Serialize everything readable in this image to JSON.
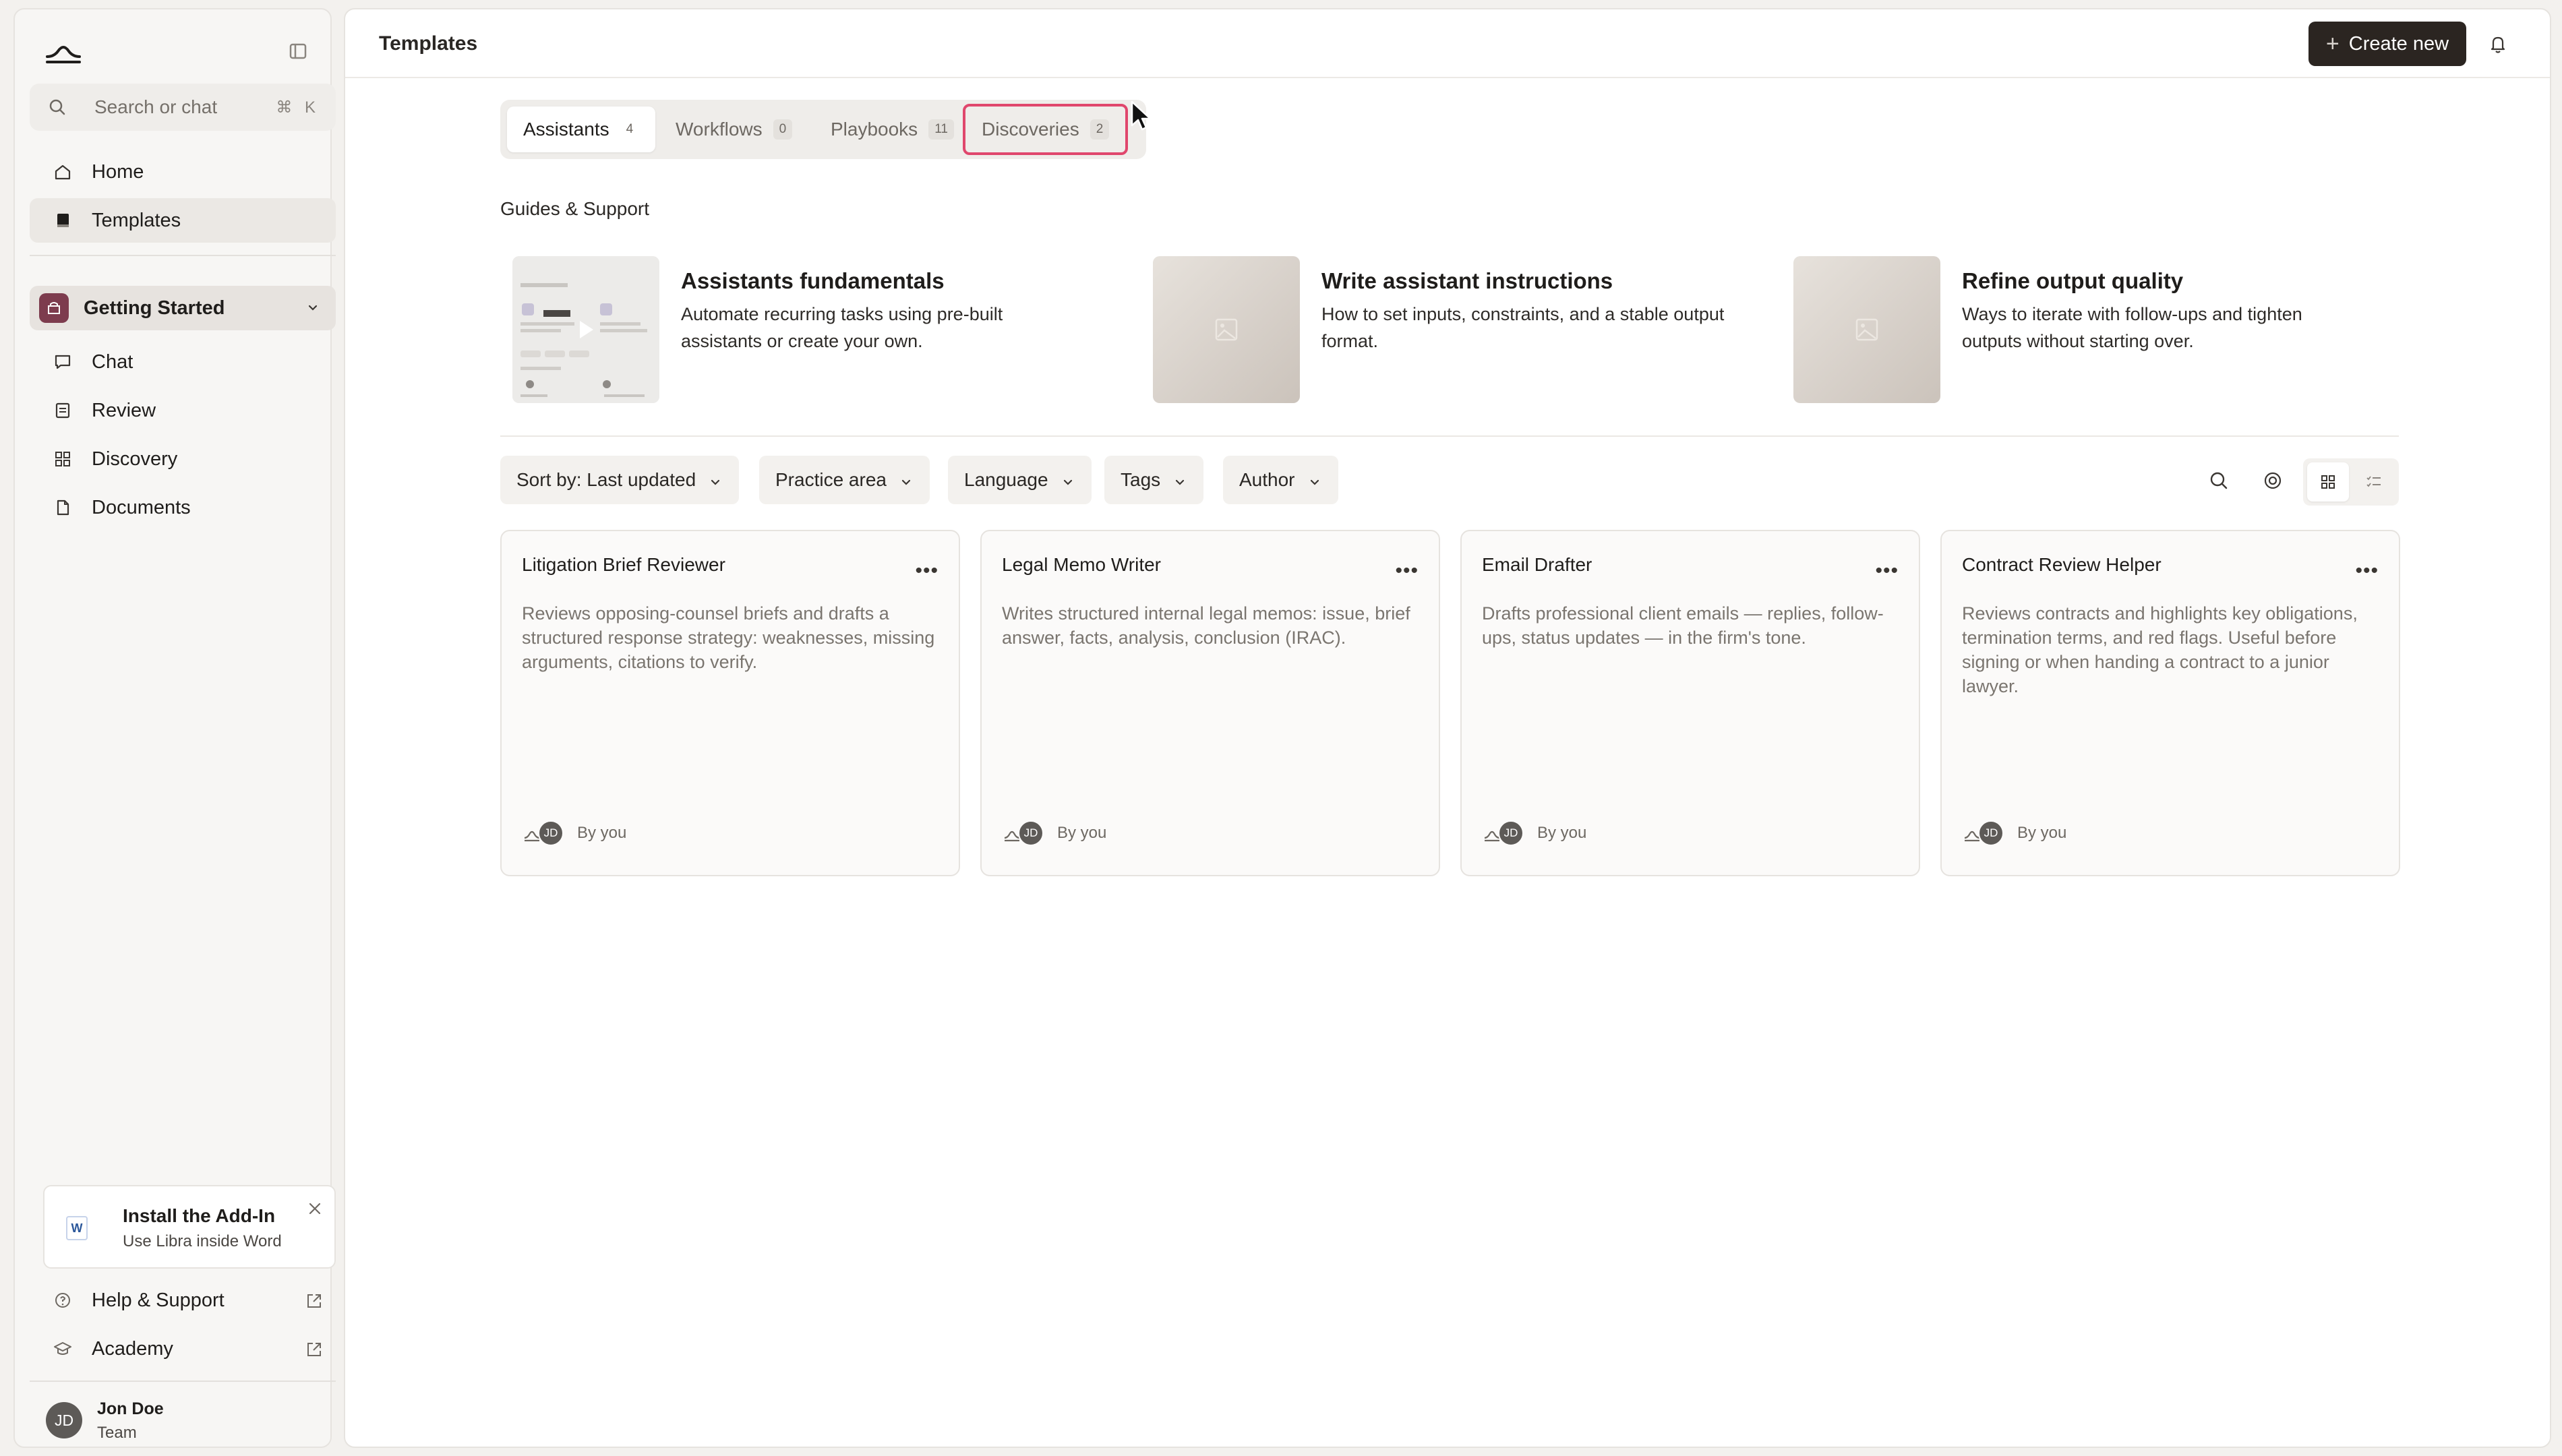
{
  "sidebar": {
    "search_placeholder": "Search or chat",
    "search_shortcut": "⌘ K",
    "nav": [
      {
        "label": "Home",
        "icon": "home-icon"
      },
      {
        "label": "Templates",
        "icon": "templates-icon"
      }
    ],
    "workspace": {
      "label": "Getting Started"
    },
    "workspace_nav": [
      {
        "label": "Chat",
        "icon": "chat-icon"
      },
      {
        "label": "Review",
        "icon": "review-icon"
      },
      {
        "label": "Discovery",
        "icon": "discovery-icon"
      },
      {
        "label": "Documents",
        "icon": "documents-icon"
      }
    ],
    "addin": {
      "title": "Install the Add-In",
      "subtitle": "Use Libra inside Word",
      "word_letter": "W"
    },
    "footer_links": [
      {
        "label": "Help & Support",
        "icon": "help-icon"
      },
      {
        "label": "Academy",
        "icon": "academy-icon"
      }
    ],
    "user": {
      "initials": "JD",
      "name": "Jon Doe",
      "team": "Team"
    }
  },
  "header": {
    "title": "Templates",
    "create_label": "Create new"
  },
  "tabs": [
    {
      "label": "Assistants",
      "count": "4"
    },
    {
      "label": "Workflows",
      "count": "0"
    },
    {
      "label": "Playbooks",
      "count": "11"
    },
    {
      "label": "Discoveries",
      "count": "2"
    }
  ],
  "guides": {
    "section_label": "Guides & Support",
    "items": [
      {
        "title": "Assistants fundamentals",
        "desc": "Automate recurring tasks using pre-built assistants or create your own."
      },
      {
        "title": "Write assistant instructions",
        "desc": "How to set inputs, constraints, and a stable output format."
      },
      {
        "title": "Refine output quality",
        "desc": "Ways to iterate with follow-ups and tighten outputs without starting over."
      }
    ]
  },
  "filters": {
    "sort_label": "Sort by: Last updated",
    "practice_area": "Practice area",
    "language": "Language",
    "tags": "Tags",
    "author": "Author"
  },
  "cards": [
    {
      "title": "Litigation Brief Reviewer",
      "desc": "Reviews opposing-counsel briefs and drafts a structured response strategy: weaknesses, missing arguments, citations to verify.",
      "author_initials": "JD",
      "by": "By you"
    },
    {
      "title": "Legal Memo Writer",
      "desc": "Writes structured internal legal memos: issue, brief answer, facts, analysis, conclusion (IRAC).",
      "author_initials": "JD",
      "by": "By you"
    },
    {
      "title": "Email Drafter",
      "desc": "Drafts professional client emails — replies, follow-ups, status updates — in the firm's tone.",
      "author_initials": "JD",
      "by": "By you"
    },
    {
      "title": "Contract Review Helper",
      "desc": "Reviews contracts and highlights key obligations, termination terms, and red flags. Useful before signing or when handing a contract to a junior lawyer.",
      "author_initials": "JD",
      "by": "By you"
    }
  ],
  "colors": {
    "accent": "#2b2521",
    "highlight": "#e0476d",
    "workspace": "#7d3c4e"
  }
}
